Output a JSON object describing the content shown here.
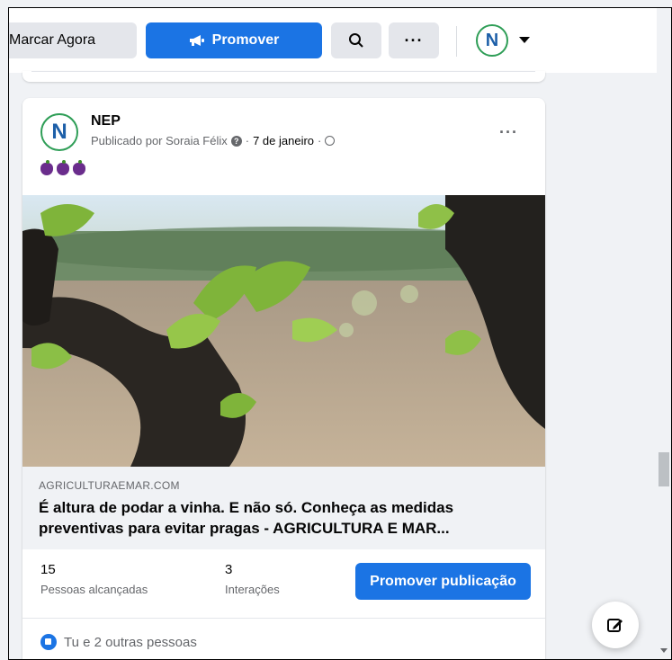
{
  "topbar": {
    "schedule_label": "Marcar Agora",
    "promote_label": "Promover"
  },
  "post": {
    "page_name": "NEP",
    "published_by": "Publicado por Soraia Félix",
    "date": "7 de janeiro",
    "emoji": "🍇🍇🍇",
    "link": {
      "domain": "AGRICULTURAEMAR.COM",
      "title": "É altura de podar a vinha. E não só. Conheça as medidas preventivas para evitar pragas - AGRICULTURA E MAR..."
    },
    "stats": {
      "reach_value": "15",
      "reach_label": "Pessoas alcançadas",
      "interactions_value": "3",
      "interactions_label": "Interações"
    },
    "promote_post_label": "Promover publicação",
    "reactions_text": "Tu e 2 outras pessoas"
  },
  "colors": {
    "primary_blue": "#1b74e4",
    "background": "#f0f2f5",
    "logo_green": "#2f9e57"
  },
  "icons": [
    "megaphone-icon",
    "search-icon",
    "more-icon",
    "page-logo-icon",
    "caret-down-icon",
    "info-icon",
    "globe-icon",
    "like-icon",
    "compose-icon"
  ]
}
